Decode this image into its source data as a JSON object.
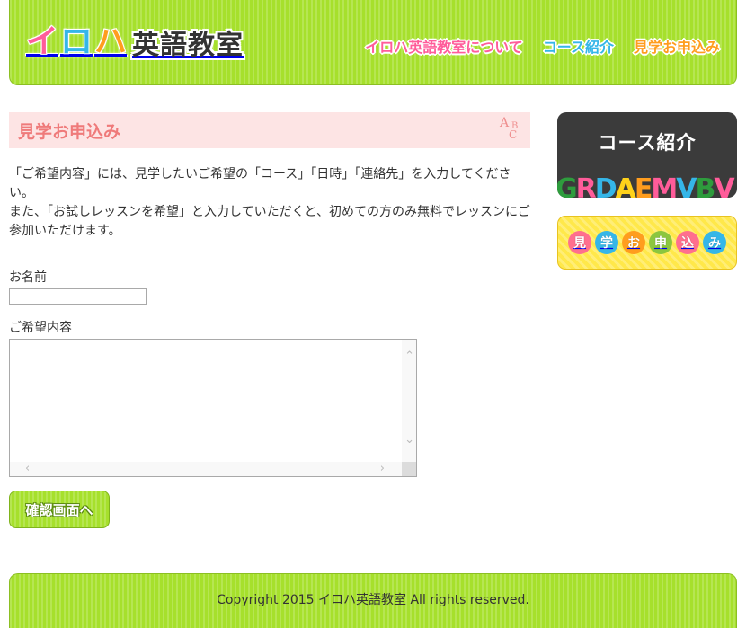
{
  "header": {
    "logo": {
      "kana": [
        "イ",
        "ロ",
        "ハ"
      ],
      "kanji": "英語教室"
    },
    "nav": [
      {
        "label": "イロハ英語教室について"
      },
      {
        "label": "コース紹介"
      },
      {
        "label": "見学お申込み"
      }
    ]
  },
  "main": {
    "title": "見学お申込み",
    "title_icon": "abc-letters-icon",
    "intro": [
      "「ご希望内容」には、見学したいご希望の「コース」「日時」「連絡先」を入力してください。",
      "また、「お試しレッスンを希望」と入力していただくと、初めての方のみ無料でレッスンにご参加いただけます。"
    ],
    "form": {
      "name_label": "お名前",
      "name_value": "",
      "request_label": "ご希望内容",
      "request_value": "",
      "submit_label": "確認画面へ"
    }
  },
  "sidebar": {
    "course_banner": {
      "title": "コース紹介",
      "letters": [
        "G",
        "R",
        "D",
        "A",
        "E",
        "M",
        "V",
        "B",
        "V"
      ]
    },
    "apply_banner": {
      "chars": [
        "見",
        "学",
        "お",
        "申",
        "込",
        "み"
      ]
    }
  },
  "footer": {
    "copyright": "Copyright 2015 イロハ英語教室 All rights reserved."
  },
  "colors": {
    "header_green": "#a6e02c",
    "title_pink": "#ef7a7a",
    "title_bg": "#fde4e4",
    "nav_pink": "#ff5c9a",
    "nav_blue": "#35b6e8",
    "nav_orange": "#ff9d1e",
    "apply_yellow": "#ffe84a",
    "letter_colors": [
      "#2e9c3d",
      "#ff5c9a",
      "#35b6e8",
      "#ffd21a",
      "#ff9d1e",
      "#ff5c9a",
      "#35b6e8",
      "#2e9c3d",
      "#ff5c9a"
    ],
    "circle_colors": [
      "#ff6f8e",
      "#35b6e8",
      "#ff9d1e",
      "#8cc63f",
      "#ff6f8e",
      "#35b6e8"
    ]
  }
}
